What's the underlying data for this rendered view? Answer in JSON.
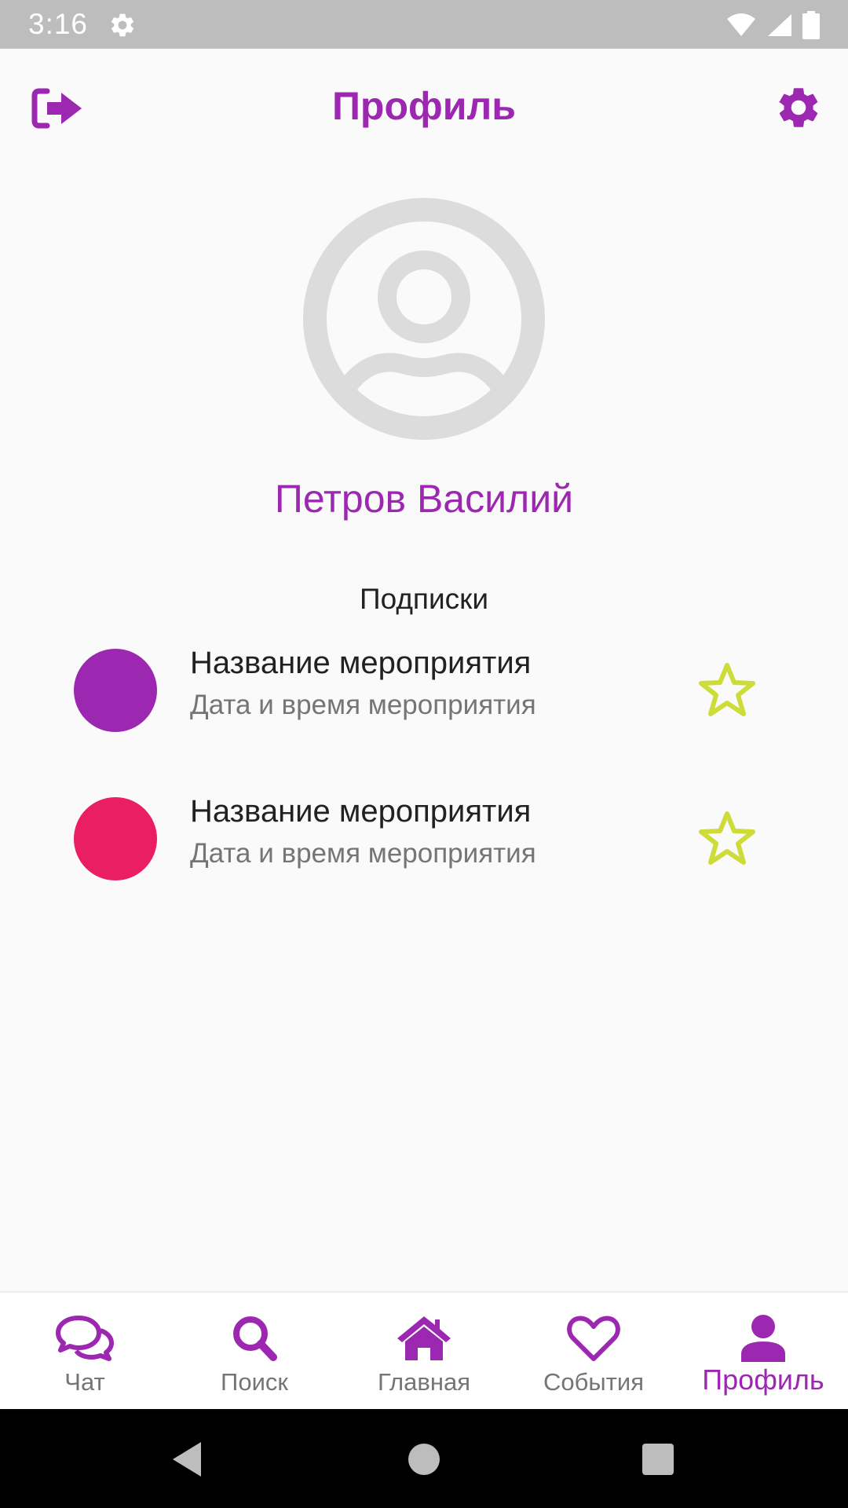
{
  "status_bar": {
    "time": "3:16",
    "icons": [
      "settings-icon",
      "wifi-icon",
      "signal-icon",
      "battery-icon"
    ]
  },
  "header": {
    "title": "Профиль",
    "left_icon": "logout-icon",
    "right_icon": "gear-icon"
  },
  "profile": {
    "avatar_icon": "account-circle-icon",
    "name": "Петров Василий"
  },
  "subscriptions": {
    "title": "Подписки",
    "items": [
      {
        "name": "Название мероприятия",
        "date": "Дата и время мероприятия",
        "color": "#9c27b0",
        "icon": "star-outline-icon"
      },
      {
        "name": "Название мероприятия",
        "date": "Дата и время мероприятия",
        "color": "#e91e63",
        "icon": "star-outline-icon"
      }
    ]
  },
  "bottom_nav": {
    "items": [
      {
        "label": "Чат",
        "icon": "chat-bubbles-icon"
      },
      {
        "label": "Поиск",
        "icon": "search-icon"
      },
      {
        "label": "Главная",
        "icon": "home-icon"
      },
      {
        "label": "События",
        "icon": "heart-outline-icon"
      },
      {
        "label": "Профиль",
        "icon": "person-icon",
        "active": true
      }
    ]
  },
  "colors": {
    "accent": "#9c27b0",
    "star": "#cddc39",
    "pink": "#e91e63"
  }
}
